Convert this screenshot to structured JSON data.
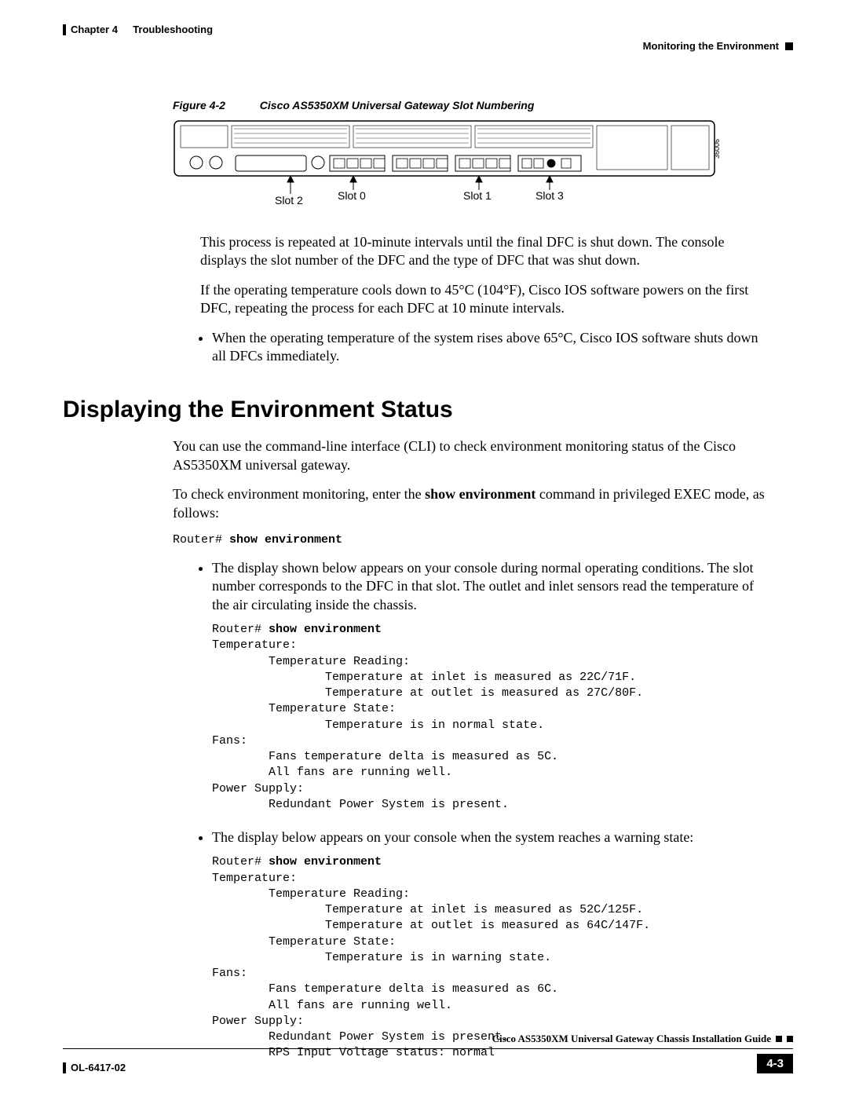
{
  "header": {
    "chapter_label": "Chapter 4",
    "chapter_title": "Troubleshooting",
    "section_label": "Monitoring the Environment"
  },
  "figure": {
    "number": "Figure 4-2",
    "title": "Cisco AS5350XM Universal Gateway Slot Numbering",
    "diagram_id": "36006",
    "slots": {
      "slot2": "Slot 2",
      "slot0": "Slot 0",
      "slot1": "Slot 1",
      "slot3": "Slot 3"
    }
  },
  "body": {
    "p1": "This process is repeated at 10-minute intervals until the final DFC is shut down. The console displays the slot number of the DFC and the type of DFC that was shut down.",
    "p2": "If the operating temperature cools down to 45°C (104°F), Cisco IOS software powers on the first DFC, repeating the process for each DFC at 10 minute intervals.",
    "bullet1": "When the operating temperature of the system rises above 65°C, Cisco IOS software shuts down all DFCs immediately."
  },
  "section_heading": "Displaying the Environment Status",
  "intro": {
    "p1": "You can use the command-line interface (CLI) to check environment monitoring status of the Cisco AS5350XM universal gateway.",
    "p2_a": "To check environment monitoring, enter the ",
    "p2_cmd": "show environment",
    "p2_b": " command in privileged EXEC mode, as follows:"
  },
  "cli": {
    "prompt": "Router# ",
    "command": "show environment"
  },
  "bullets": {
    "normal_intro": "The display shown below appears on your console during normal operating conditions. The slot number corresponds to the DFC in that slot. The outlet and inlet sensors read the temperature of the air circulating inside the chassis.",
    "warning_intro": "The display below appears on your console when the system reaches a warning state:"
  },
  "console_normal": {
    "prompt": "Router# ",
    "command": "show environment",
    "l1": "Temperature:",
    "l2": "        Temperature Reading:",
    "l3": "                Temperature at inlet is measured as 22C/71F.",
    "l4": "                Temperature at outlet is measured as 27C/80F.",
    "l5": "        Temperature State:",
    "l6": "                Temperature is in normal state.",
    "l7": "Fans:",
    "l8": "        Fans temperature delta is measured as 5C.",
    "l9": "        All fans are running well.",
    "l10": "Power Supply:",
    "l11": "        Redundant Power System is present."
  },
  "console_warning": {
    "prompt": "Router# ",
    "command": "show environment",
    "l1": "Temperature:",
    "l2": "        Temperature Reading:",
    "l3": "                Temperature at inlet is measured as 52C/125F.",
    "l4": "                Temperature at outlet is measured as 64C/147F.",
    "l5": "        Temperature State:",
    "l6": "                Temperature is in warning state.",
    "l7": "Fans:",
    "l8": "        Fans temperature delta is measured as 6C.",
    "l9": "        All fans are running well.",
    "l10": "Power Supply:",
    "l11": "        Redundant Power System is present.",
    "l12": "        RPS Input Voltage status: normal"
  },
  "footer": {
    "guide_title": "Cisco AS5350XM Universal Gateway Chassis Installation Guide",
    "doc_id": "OL-6417-02",
    "page": "4-3"
  }
}
